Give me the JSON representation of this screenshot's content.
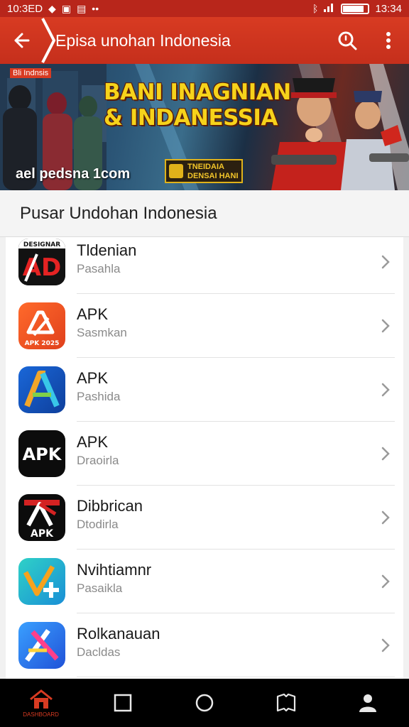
{
  "status_bar": {
    "time_left": "10:3ED",
    "time_right": "13:34",
    "battery_level": 0.85,
    "icons_left": [
      "diamond-icon",
      "app-icon",
      "photo-icon",
      "more-dots-icon"
    ],
    "icons_right": [
      "bluetooth-icon",
      "signal-icon",
      "battery-icon"
    ]
  },
  "app_bar": {
    "title": "Episa unohan Indonesia",
    "color": "#d83b22"
  },
  "banner": {
    "tag": "Bli Indnsis",
    "headline_line1": "BANI INAGNIAN",
    "headline_line2": "& INDANESSIA",
    "site_text": "ael pedsna 1com",
    "badge_line1": "TNEIDAIA",
    "badge_line2": "DENSAI HANI"
  },
  "section": {
    "title": "Pusar Undohan Indonesia"
  },
  "apps": [
    {
      "name": "Tldenian",
      "subtitle": "Pasahla",
      "icon": "black-red-ad-icon"
    },
    {
      "name": "APK",
      "subtitle": "Sasmkan",
      "icon": "orange-apk-icon"
    },
    {
      "name": "APK",
      "subtitle": "Pashida",
      "icon": "blue-a-icon"
    },
    {
      "name": "APK",
      "subtitle": "Draoirla",
      "icon": "black-apk-text-icon"
    },
    {
      "name": "Dibbrican",
      "subtitle": "Dtodirla",
      "icon": "black-red-apk-icon"
    },
    {
      "name": "Nvihtiamnr",
      "subtitle": "Pasaikla",
      "icon": "teal-plus-icon"
    },
    {
      "name": "Rolkanauan",
      "subtitle": "Dacldas",
      "icon": "blue-x-icon"
    }
  ],
  "app_icon_texts": {
    "icon1_top": "DESIGNAR",
    "icon1_main": "AD",
    "icon2_bottom": "APK 2025",
    "icon4_main": "APK",
    "icon5_main": "APK"
  },
  "bottom_nav": {
    "items": [
      "home-icon",
      "square-icon",
      "circle-icon",
      "book-icon",
      "profile-icon"
    ],
    "active_label": "DASHBOARD",
    "active_color": "#d83b22"
  }
}
